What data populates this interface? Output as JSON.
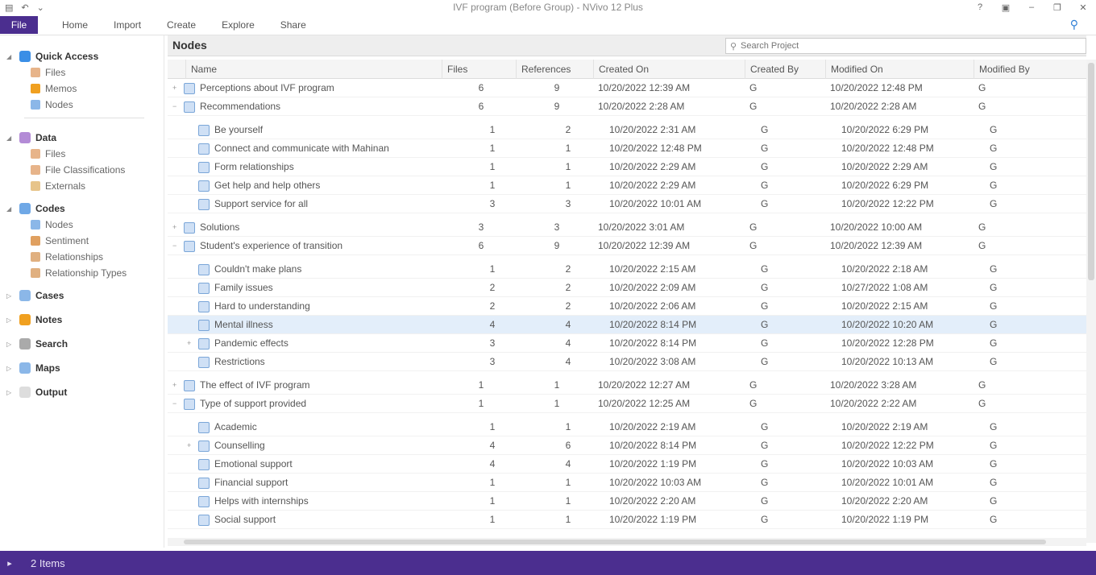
{
  "window": {
    "title": "IVF program (Before Group) - NVivo 12 Plus",
    "qat": [
      "save-icon",
      "undo-icon",
      "redo-icon"
    ],
    "controls": [
      "?",
      "▣",
      "–",
      "❐",
      "✕"
    ]
  },
  "ribbon": {
    "file": "File",
    "tabs": [
      "Home",
      "Import",
      "Create",
      "Explore",
      "Share"
    ]
  },
  "nav": {
    "groups": [
      {
        "label": "Quick Access",
        "color": "#3a8ee6",
        "items": [
          {
            "label": "Files",
            "color": "#e7b48a"
          },
          {
            "label": "Memos",
            "color": "#f0a020"
          },
          {
            "label": "Nodes",
            "color": "#8bb7e8"
          }
        ]
      },
      {
        "label": "Data",
        "color": "#b38bd6",
        "items": [
          {
            "label": "Files",
            "color": "#e7b48a"
          },
          {
            "label": "File Classifications",
            "color": "#e7b48a"
          },
          {
            "label": "Externals",
            "color": "#e7c48a"
          }
        ]
      },
      {
        "label": "Codes",
        "color": "#6fa8e6",
        "items": [
          {
            "label": "Nodes",
            "color": "#8bb7e8"
          },
          {
            "label": "Sentiment",
            "color": "#e0a060"
          },
          {
            "label": "Relationships",
            "color": "#e0b080"
          },
          {
            "label": "Relationship Types",
            "color": "#e0b080"
          }
        ]
      },
      {
        "label": "Cases",
        "color": "#8bb7e8",
        "items": []
      },
      {
        "label": "Notes",
        "color": "#f0a020",
        "items": []
      },
      {
        "label": "Search",
        "color": "#aaaaaa",
        "items": []
      },
      {
        "label": "Maps",
        "color": "#8bb7e8",
        "items": []
      },
      {
        "label": "Output",
        "color": "#dddddd",
        "items": []
      }
    ]
  },
  "main": {
    "title": "Nodes",
    "search_placeholder": "Search Project",
    "columns": [
      "Name",
      "Files",
      "References",
      "Created On",
      "Created By",
      "Modified On",
      "Modified By"
    ],
    "rows": [
      {
        "level": 0,
        "expander": "+",
        "name": "Perceptions about IVF program",
        "files": "6",
        "refs": "9",
        "created": "10/20/2022 12:39 AM",
        "cby": "G",
        "modified": "10/20/2022 12:48 PM",
        "mby": "G"
      },
      {
        "level": 0,
        "expander": "−",
        "name": "Recommendations",
        "files": "6",
        "refs": "9",
        "created": "10/20/2022 2:28 AM",
        "cby": "G",
        "modified": "10/20/2022 2:28 AM",
        "mby": "G"
      },
      {
        "level": 1,
        "expander": "",
        "name": "Be yourself",
        "files": "1",
        "refs": "2",
        "created": "10/20/2022 2:31 AM",
        "cby": "G",
        "modified": "10/20/2022 6:29 PM",
        "mby": "G",
        "gap": true
      },
      {
        "level": 1,
        "expander": "",
        "name": "Connect and communicate with Mahinan",
        "files": "1",
        "refs": "1",
        "created": "10/20/2022 12:48 PM",
        "cby": "G",
        "modified": "10/20/2022 12:48 PM",
        "mby": "G"
      },
      {
        "level": 1,
        "expander": "",
        "name": "Form relationships",
        "files": "1",
        "refs": "1",
        "created": "10/20/2022 2:29 AM",
        "cby": "G",
        "modified": "10/20/2022 2:29 AM",
        "mby": "G"
      },
      {
        "level": 1,
        "expander": "",
        "name": "Get help and help others",
        "files": "1",
        "refs": "1",
        "created": "10/20/2022 2:29 AM",
        "cby": "G",
        "modified": "10/20/2022 6:29 PM",
        "mby": "G"
      },
      {
        "level": 1,
        "expander": "",
        "name": "Support service for all",
        "files": "3",
        "refs": "3",
        "created": "10/20/2022 10:01 AM",
        "cby": "G",
        "modified": "10/20/2022 12:22 PM",
        "mby": "G"
      },
      {
        "level": 0,
        "expander": "+",
        "name": "Solutions",
        "files": "3",
        "refs": "3",
        "created": "10/20/2022 3:01 AM",
        "cby": "G",
        "modified": "10/20/2022 10:00 AM",
        "mby": "G",
        "gap": true
      },
      {
        "level": 0,
        "expander": "−",
        "name": "Student's experience of transition",
        "files": "6",
        "refs": "9",
        "created": "10/20/2022 12:39 AM",
        "cby": "G",
        "modified": "10/20/2022 12:39 AM",
        "mby": "G"
      },
      {
        "level": 1,
        "expander": "",
        "name": "Couldn't make plans",
        "files": "1",
        "refs": "2",
        "created": "10/20/2022 2:15 AM",
        "cby": "G",
        "modified": "10/20/2022 2:18 AM",
        "mby": "G",
        "gap": true
      },
      {
        "level": 1,
        "expander": "",
        "name": "Family issues",
        "files": "2",
        "refs": "2",
        "created": "10/20/2022 2:09 AM",
        "cby": "G",
        "modified": "10/27/2022 1:08 AM",
        "mby": "G"
      },
      {
        "level": 1,
        "expander": "",
        "name": "Hard to understanding",
        "files": "2",
        "refs": "2",
        "created": "10/20/2022 2:06 AM",
        "cby": "G",
        "modified": "10/20/2022 2:15 AM",
        "mby": "G"
      },
      {
        "level": 1,
        "expander": "",
        "name": "Mental illness",
        "files": "4",
        "refs": "4",
        "created": "10/20/2022 8:14 PM",
        "cby": "G",
        "modified": "10/20/2022 10:20 AM",
        "mby": "G",
        "selected": true
      },
      {
        "level": 1,
        "expander": "+",
        "name": "Pandemic effects",
        "files": "3",
        "refs": "4",
        "created": "10/20/2022 8:14 PM",
        "cby": "G",
        "modified": "10/20/2022 12:28 PM",
        "mby": "G"
      },
      {
        "level": 1,
        "expander": "",
        "name": "Restrictions",
        "files": "3",
        "refs": "4",
        "created": "10/20/2022 3:08 AM",
        "cby": "G",
        "modified": "10/20/2022 10:13 AM",
        "mby": "G"
      },
      {
        "level": 0,
        "expander": "+",
        "name": "The effect of IVF program",
        "files": "1",
        "refs": "1",
        "created": "10/20/2022 12:27 AM",
        "cby": "G",
        "modified": "10/20/2022 3:28 AM",
        "mby": "G",
        "gap": true
      },
      {
        "level": 0,
        "expander": "−",
        "name": "Type of support provided",
        "files": "1",
        "refs": "1",
        "created": "10/20/2022 12:25 AM",
        "cby": "G",
        "modified": "10/20/2022 2:22 AM",
        "mby": "G"
      },
      {
        "level": 1,
        "expander": "",
        "name": "Academic",
        "files": "1",
        "refs": "1",
        "created": "10/20/2022 2:19 AM",
        "cby": "G",
        "modified": "10/20/2022 2:19 AM",
        "mby": "G",
        "gap": true
      },
      {
        "level": 1,
        "expander": "+",
        "name": "Counselling",
        "files": "4",
        "refs": "6",
        "created": "10/20/2022 8:14 PM",
        "cby": "G",
        "modified": "10/20/2022 12:22 PM",
        "mby": "G"
      },
      {
        "level": 1,
        "expander": "",
        "name": "Emotional support",
        "files": "4",
        "refs": "4",
        "created": "10/20/2022 1:19 PM",
        "cby": "G",
        "modified": "10/20/2022 10:03 AM",
        "mby": "G"
      },
      {
        "level": 1,
        "expander": "",
        "name": "Financial support",
        "files": "1",
        "refs": "1",
        "created": "10/20/2022 10:03 AM",
        "cby": "G",
        "modified": "10/20/2022 10:01 AM",
        "mby": "G"
      },
      {
        "level": 1,
        "expander": "",
        "name": "Helps with internships",
        "files": "1",
        "refs": "1",
        "created": "10/20/2022 2:20 AM",
        "cby": "G",
        "modified": "10/20/2022 2:20 AM",
        "mby": "G"
      },
      {
        "level": 1,
        "expander": "",
        "name": "Social support",
        "files": "1",
        "refs": "1",
        "created": "10/20/2022 1:19 PM",
        "cby": "G",
        "modified": "10/20/2022 1:19 PM",
        "mby": "G"
      }
    ]
  },
  "status": {
    "text": "2 Items"
  }
}
